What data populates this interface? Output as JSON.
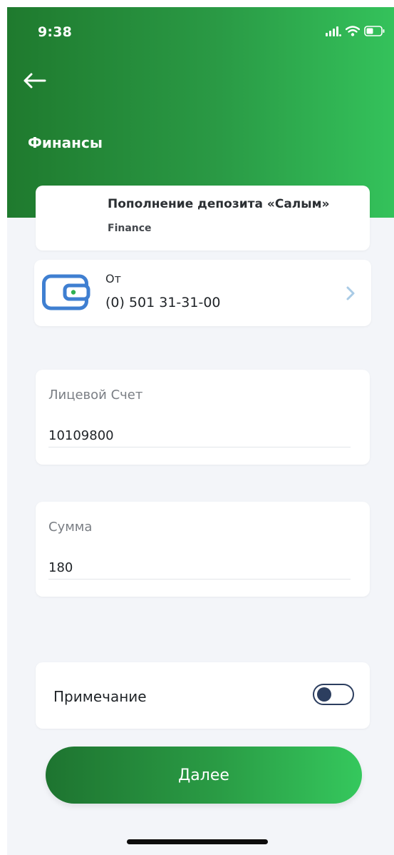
{
  "status_bar": {
    "time": "9:38",
    "icons": [
      "cellular-signal-icon",
      "wifi-icon",
      "battery-icon"
    ]
  },
  "header": {
    "back_icon": "arrow-left-icon",
    "title": "Финансы"
  },
  "service": {
    "title": "Пополнение депозита «Салым»",
    "subtitle": "Finance"
  },
  "from": {
    "icon": "wallet-icon",
    "label": "От",
    "value": "(0) 501 31-31-00"
  },
  "fields": {
    "account": {
      "label": "Лицевой Счет",
      "value": "10109800"
    },
    "amount": {
      "label": "Сумма",
      "value": "180"
    }
  },
  "note": {
    "label": "Примечание",
    "enabled": false
  },
  "next_button": {
    "label": "Далее"
  },
  "colors": {
    "brand_green_dark": "#1f7a2e",
    "brand_green_light": "#34c25b",
    "background": "#f3f5f9",
    "wallet_blue": "#3f7fd1",
    "toggle_navy": "#2c3e5f",
    "chevron_light_blue": "#a9cbe6"
  }
}
